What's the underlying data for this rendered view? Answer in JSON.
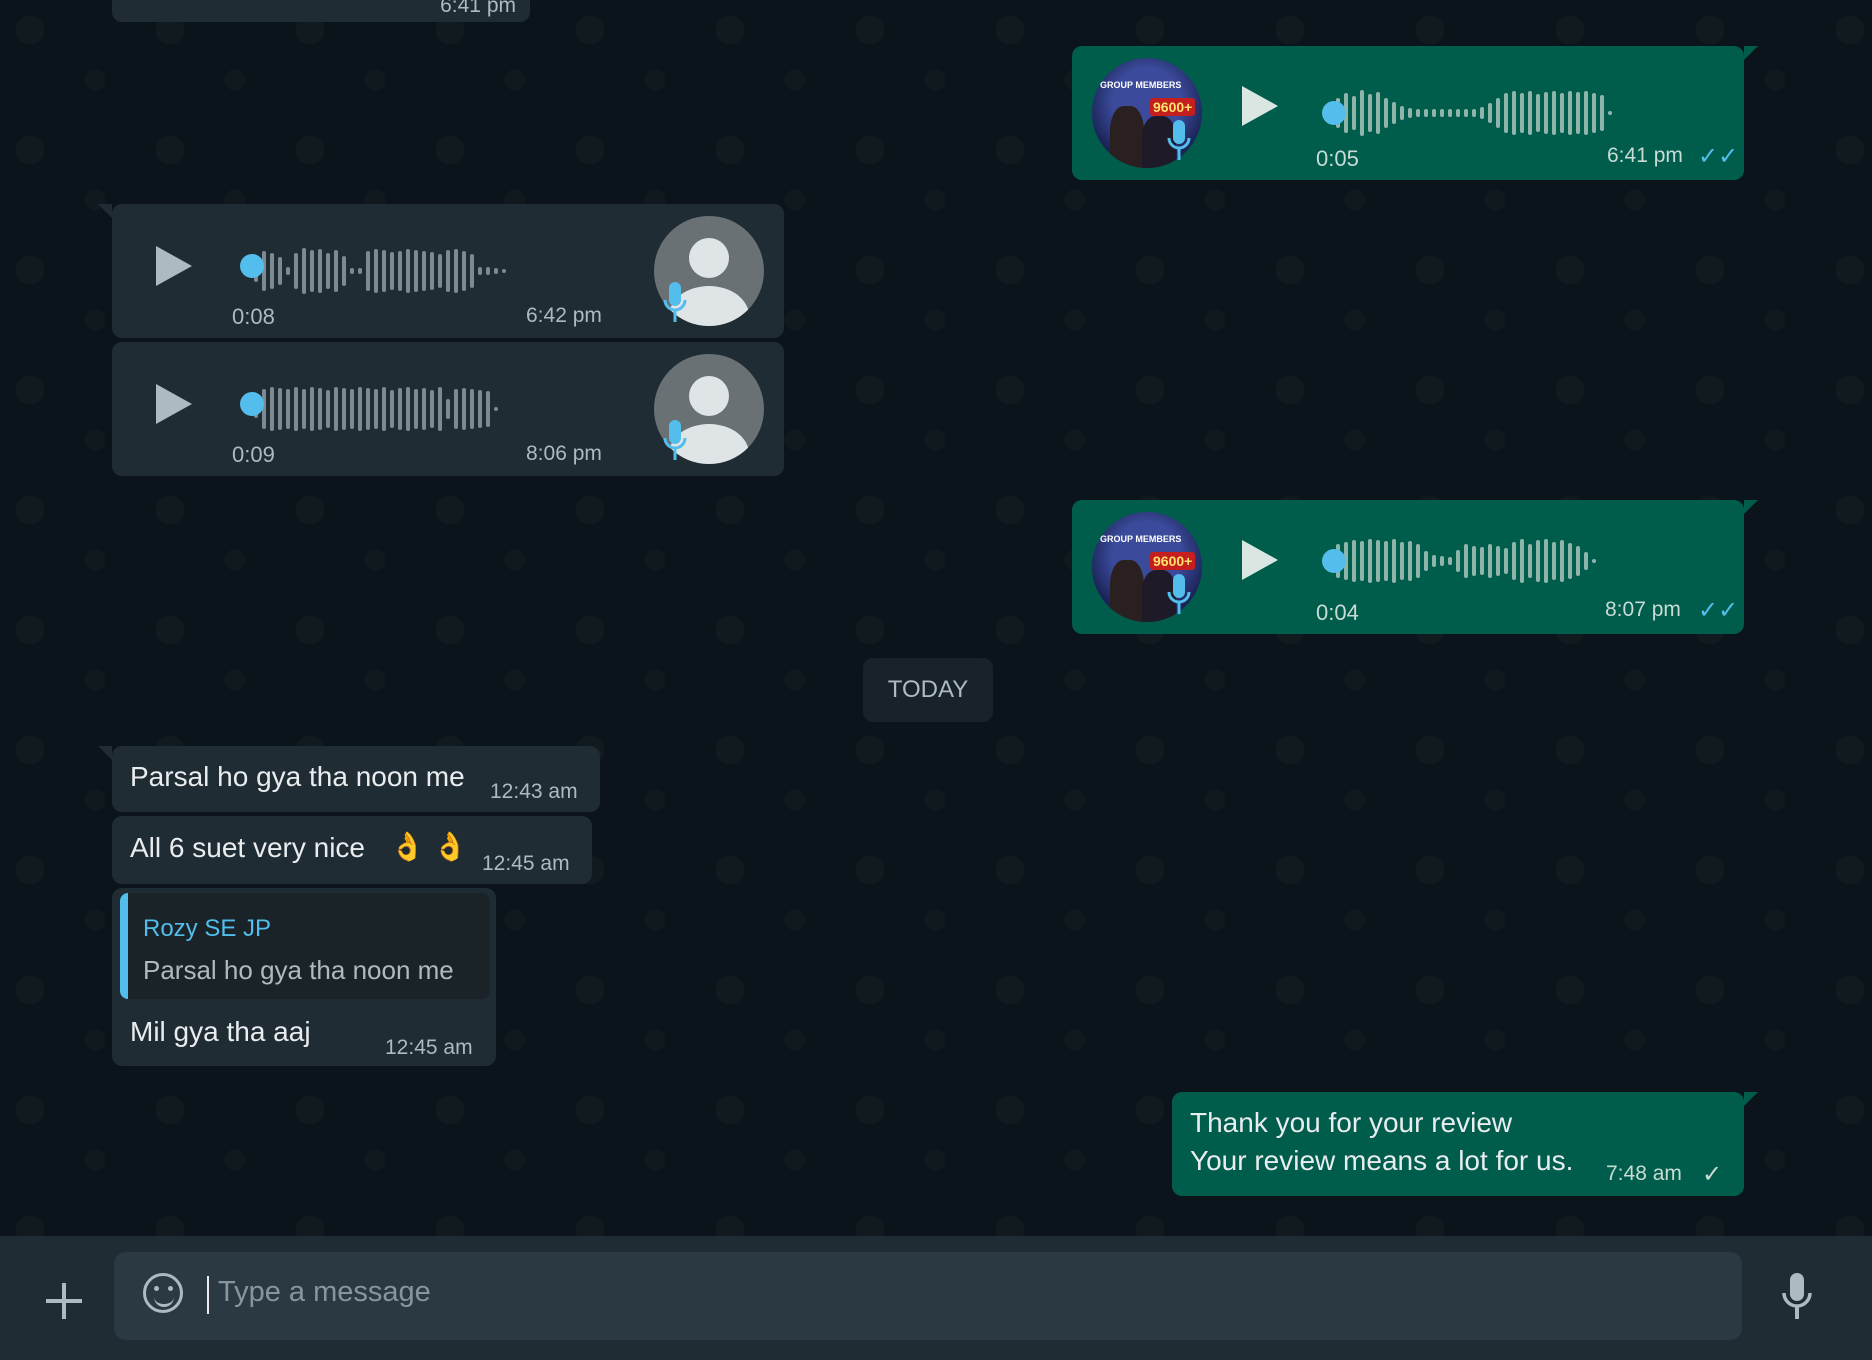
{
  "partial_top": {
    "time": "6:41 pm"
  },
  "voice_out_1": {
    "duration": "0:05",
    "time": "6:41 pm",
    "status": "read",
    "ticks": "✓✓"
  },
  "voice_in_1": {
    "duration": "0:08",
    "time": "6:42 pm"
  },
  "voice_in_2": {
    "duration": "0:09",
    "time": "8:06 pm"
  },
  "voice_out_2": {
    "duration": "0:04",
    "time": "8:07 pm",
    "status": "read",
    "ticks": "✓✓"
  },
  "date_divider": "TODAY",
  "messages": [
    {
      "text": "Parsal ho gya tha noon me",
      "time": "12:43 am"
    },
    {
      "text": "All 6 suet very nice",
      "emoji": "👌 👌",
      "time": "12:45 am"
    },
    {
      "quote_name": "Rozy SE JP",
      "quote_text": "Parsal ho gya tha noon me",
      "text": "Mil gya tha aaj",
      "time": "12:45 am"
    }
  ],
  "outgoing_text": {
    "line1": "Thank you for your review",
    "line2": "Your review means a lot for us.",
    "time": "7:48 am",
    "status": "sent",
    "ticks": "✓"
  },
  "group_avatar": {
    "badge": "9600+",
    "label": "GROUP MEMBERS"
  },
  "composer": {
    "placeholder": "Type a message"
  },
  "icons": [
    "plus-icon",
    "emoji-icon",
    "microphone-icon",
    "play-icon",
    "mic-badge-icon",
    "double-check-icon",
    "single-check-icon"
  ],
  "colors": {
    "incoming": "#202c33",
    "outgoing": "#005c4b",
    "accent": "#53bdeb",
    "background": "#0b141a"
  }
}
